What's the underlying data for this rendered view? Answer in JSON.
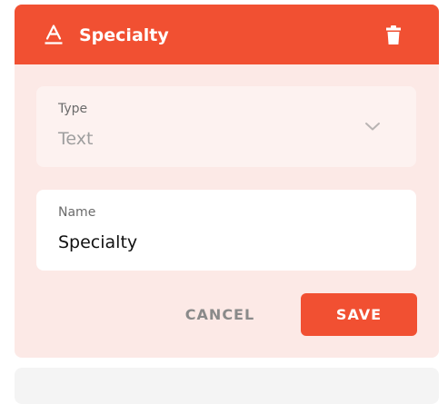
{
  "card": {
    "title": "Specialty",
    "header_icon": "text-field-icon",
    "delete_icon": "trash-icon",
    "accent_color": "#f15032",
    "background_color": "#fce9e6"
  },
  "type_field": {
    "label": "Type",
    "value": "Text",
    "icon": "chevron-down-icon"
  },
  "name_field": {
    "label": "Name",
    "value": "Specialty"
  },
  "actions": {
    "cancel_label": "CANCEL",
    "save_label": "SAVE"
  }
}
